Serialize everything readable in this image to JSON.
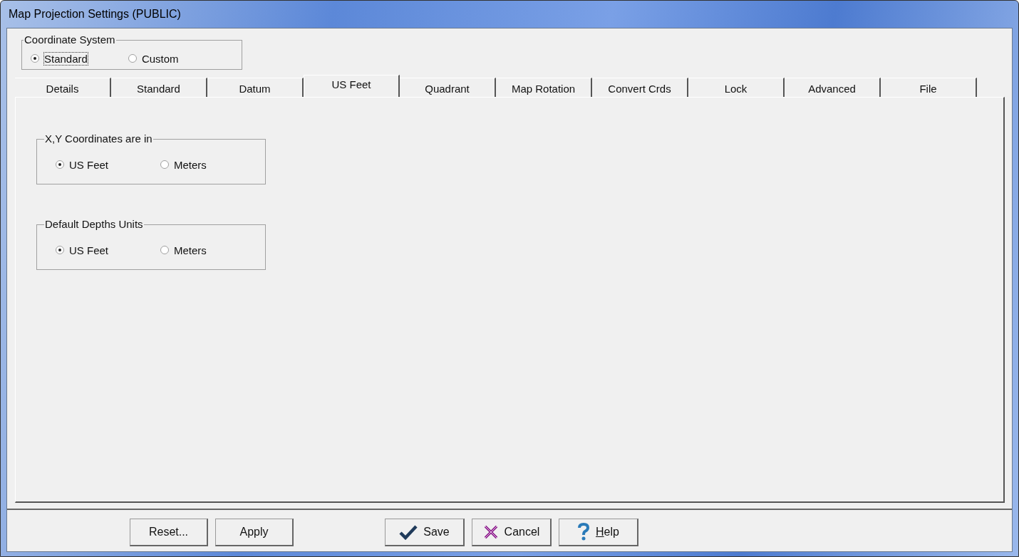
{
  "window": {
    "title": "Map Projection Settings (PUBLIC)"
  },
  "coordinate_system": {
    "label": "Coordinate System",
    "options": [
      {
        "label": "Standard",
        "selected": true
      },
      {
        "label": "Custom",
        "selected": false
      }
    ]
  },
  "tabs": [
    {
      "label": "Details",
      "selected": false
    },
    {
      "label": "Standard",
      "selected": false
    },
    {
      "label": "Datum",
      "selected": false
    },
    {
      "label": "US Feet",
      "selected": true
    },
    {
      "label": "Quadrant",
      "selected": false
    },
    {
      "label": "Map Rotation",
      "selected": false
    },
    {
      "label": "Convert Crds",
      "selected": false
    },
    {
      "label": "Lock",
      "selected": false
    },
    {
      "label": "Advanced",
      "selected": false
    },
    {
      "label": "File",
      "selected": false
    }
  ],
  "groups": [
    {
      "label": "X,Y Coordinates are in",
      "options": [
        {
          "label": "US Feet",
          "selected": true
        },
        {
          "label": "Meters",
          "selected": false
        }
      ]
    },
    {
      "label": "Default Depths Units",
      "options": [
        {
          "label": "US Feet",
          "selected": true
        },
        {
          "label": "Meters",
          "selected": false
        }
      ]
    }
  ],
  "buttons": [
    {
      "label": "Reset...",
      "kind": "plain"
    },
    {
      "label": "Apply",
      "kind": "plain"
    },
    {
      "label": "Save",
      "kind": "check"
    },
    {
      "label": "Cancel",
      "kind": "cross"
    },
    {
      "label": "Help",
      "kind": "question"
    }
  ]
}
